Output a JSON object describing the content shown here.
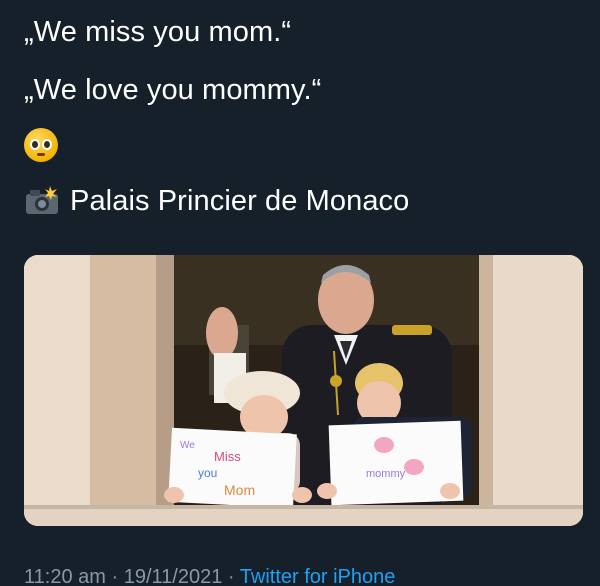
{
  "tweet": {
    "line1": "„We miss you mom.“",
    "line2": "„We love you mommy.“",
    "emoji_icon": "pleading-face-emoji",
    "camera_icon": "camera-with-flash-emoji",
    "location": "Palais Princier de Monaco",
    "sign_left_text": "We miss you mom",
    "sign_right_text": "We love you mommy",
    "time": "11:20 am",
    "date": "19/11/2021",
    "sep": "·",
    "source": "Twitter for iPhone"
  },
  "colors": {
    "background": "#15202b",
    "text": "#ffffff",
    "meta": "#8899a6",
    "link": "#1da1f2"
  }
}
